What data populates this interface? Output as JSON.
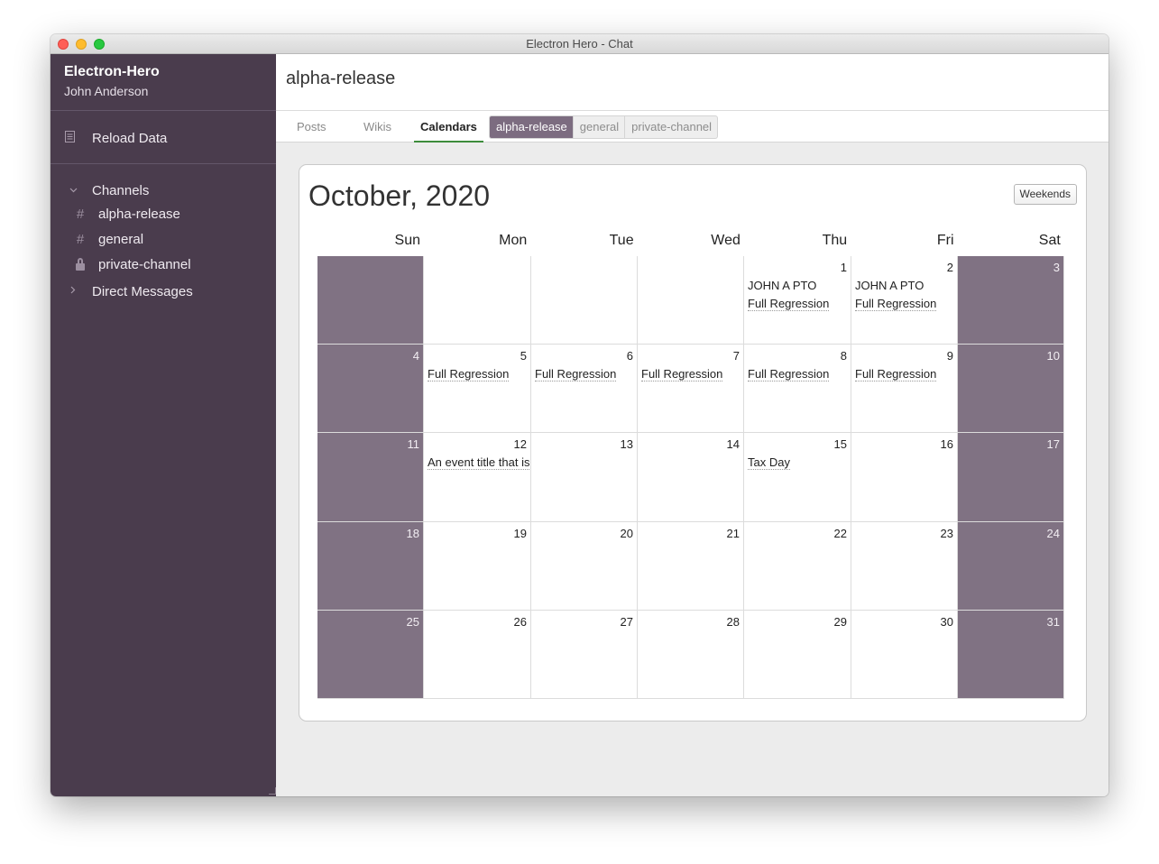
{
  "window": {
    "title": "Electron Hero - Chat"
  },
  "sidebar": {
    "team_name": "Electron-Hero",
    "user_name": "John Anderson",
    "reload_label": "Reload Data",
    "reload_icon": "document-icon",
    "channels_label": "Channels",
    "channels": [
      {
        "name": "alpha-release",
        "icon": "hash-icon"
      },
      {
        "name": "general",
        "icon": "hash-icon"
      },
      {
        "name": "private-channel",
        "icon": "lock-icon"
      }
    ],
    "direct_messages_label": "Direct Messages"
  },
  "main": {
    "channel_title": "alpha-release",
    "tabs": [
      {
        "label": "Posts",
        "active": false
      },
      {
        "label": "Wikis",
        "active": false
      },
      {
        "label": "Calendars",
        "active": true
      }
    ],
    "channel_chips": [
      {
        "label": "alpha-release",
        "active": true
      },
      {
        "label": "general",
        "active": false
      },
      {
        "label": "private-channel",
        "active": false
      }
    ]
  },
  "calendar": {
    "month_title": "October, 2020",
    "weekends_button": "Weekends",
    "weekdays": [
      "Sun",
      "Mon",
      "Tue",
      "Wed",
      "Thu",
      "Fri",
      "Sat"
    ],
    "weeks": [
      [
        {
          "day": "",
          "weekend": true,
          "events": []
        },
        {
          "day": "",
          "weekend": false,
          "events": []
        },
        {
          "day": "",
          "weekend": false,
          "events": []
        },
        {
          "day": "",
          "weekend": false,
          "events": []
        },
        {
          "day": "1",
          "weekend": false,
          "events": [
            {
              "title": "JOHN A PTO",
              "dotted": false
            },
            {
              "title": "Full Regression",
              "dotted": true
            }
          ]
        },
        {
          "day": "2",
          "weekend": false,
          "events": [
            {
              "title": "JOHN A PTO",
              "dotted": false
            },
            {
              "title": "Full Regression",
              "dotted": true
            }
          ]
        },
        {
          "day": "3",
          "weekend": true,
          "events": []
        }
      ],
      [
        {
          "day": "4",
          "weekend": true,
          "events": []
        },
        {
          "day": "5",
          "weekend": false,
          "events": [
            {
              "title": "Full Regression",
              "dotted": true
            }
          ]
        },
        {
          "day": "6",
          "weekend": false,
          "events": [
            {
              "title": "Full Regression",
              "dotted": true
            }
          ]
        },
        {
          "day": "7",
          "weekend": false,
          "events": [
            {
              "title": "Full Regression",
              "dotted": true
            }
          ]
        },
        {
          "day": "8",
          "weekend": false,
          "events": [
            {
              "title": "Full Regression",
              "dotted": true
            }
          ]
        },
        {
          "day": "9",
          "weekend": false,
          "events": [
            {
              "title": "Full Regression",
              "dotted": true
            }
          ]
        },
        {
          "day": "10",
          "weekend": true,
          "events": []
        }
      ],
      [
        {
          "day": "11",
          "weekend": true,
          "events": []
        },
        {
          "day": "12",
          "weekend": false,
          "events": [
            {
              "title": "An event title that is",
              "dotted": true
            }
          ]
        },
        {
          "day": "13",
          "weekend": false,
          "events": []
        },
        {
          "day": "14",
          "weekend": false,
          "events": []
        },
        {
          "day": "15",
          "weekend": false,
          "events": [
            {
              "title": "Tax Day",
              "dotted": true
            }
          ]
        },
        {
          "day": "16",
          "weekend": false,
          "events": []
        },
        {
          "day": "17",
          "weekend": true,
          "events": []
        }
      ],
      [
        {
          "day": "18",
          "weekend": true,
          "events": []
        },
        {
          "day": "19",
          "weekend": false,
          "events": []
        },
        {
          "day": "20",
          "weekend": false,
          "events": []
        },
        {
          "day": "21",
          "weekend": false,
          "events": []
        },
        {
          "day": "22",
          "weekend": false,
          "events": []
        },
        {
          "day": "23",
          "weekend": false,
          "events": []
        },
        {
          "day": "24",
          "weekend": true,
          "events": []
        }
      ],
      [
        {
          "day": "25",
          "weekend": true,
          "events": []
        },
        {
          "day": "26",
          "weekend": false,
          "events": []
        },
        {
          "day": "27",
          "weekend": false,
          "events": []
        },
        {
          "day": "28",
          "weekend": false,
          "events": []
        },
        {
          "day": "29",
          "weekend": false,
          "events": []
        },
        {
          "day": "30",
          "weekend": false,
          "events": []
        },
        {
          "day": "31",
          "weekend": true,
          "events": []
        }
      ]
    ]
  }
}
